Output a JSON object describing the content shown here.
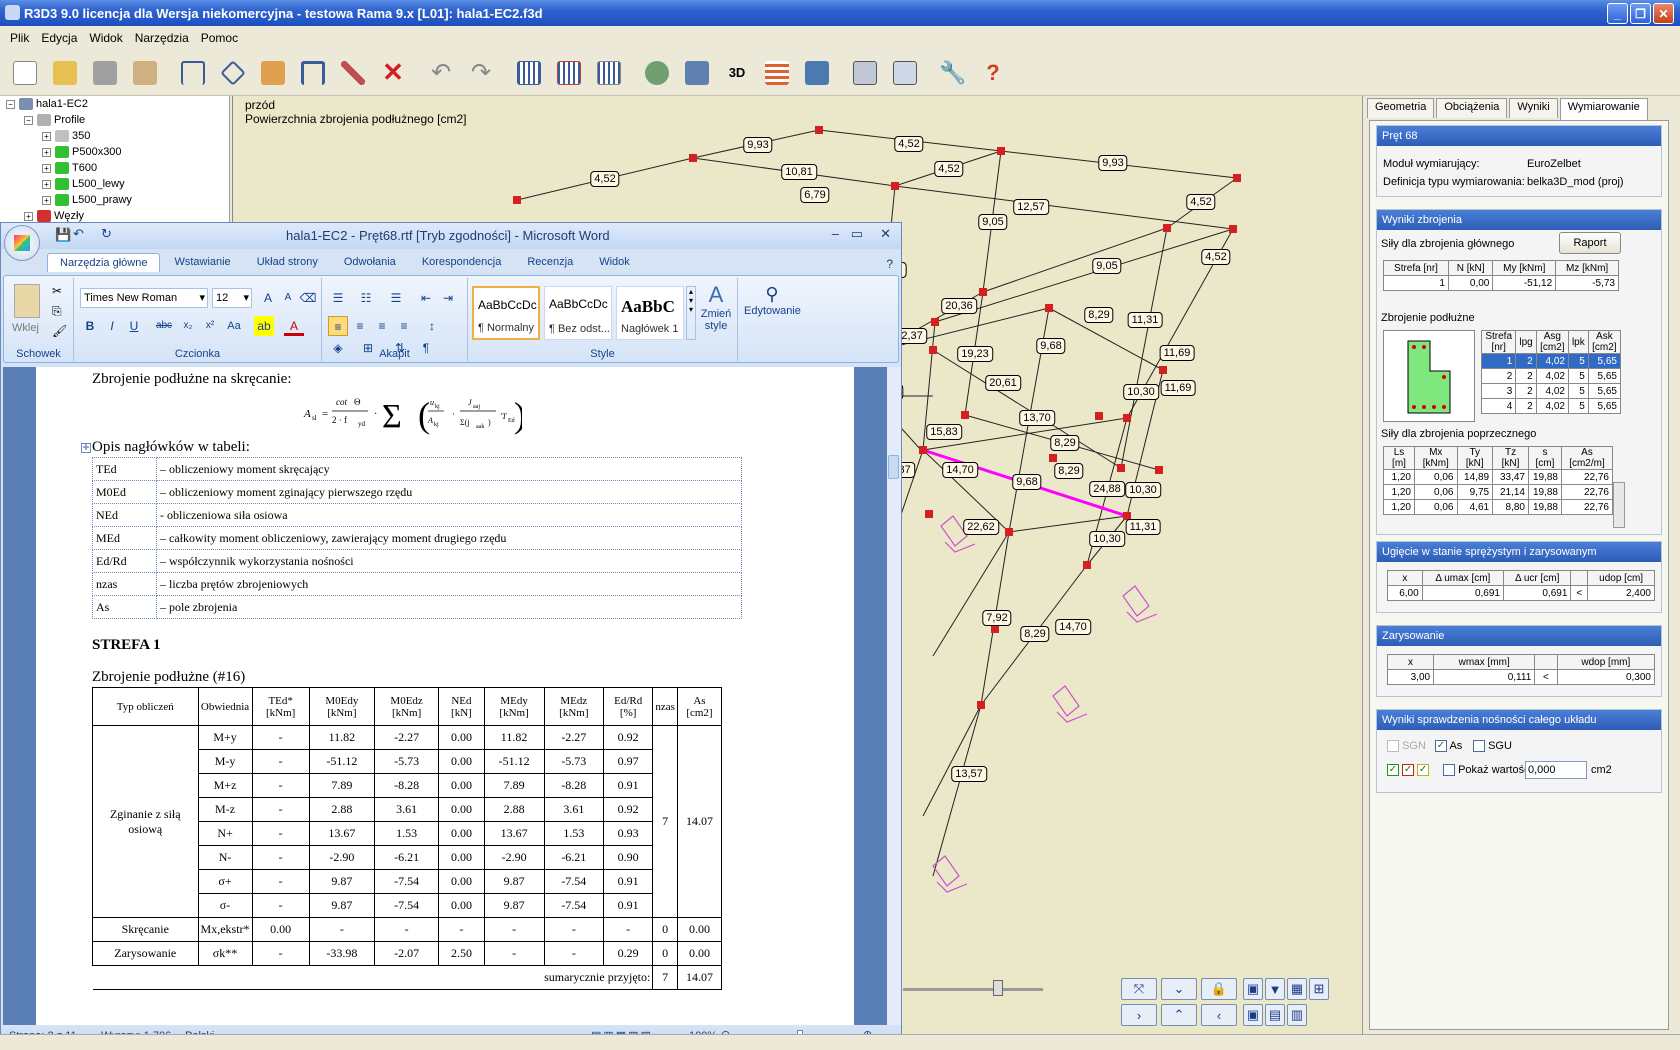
{
  "app": {
    "title": "R3D3 9.0 licencja dla Wersja niekomercyjna - testowa Rama 9.x [L01]: hala1-EC2.f3d",
    "menu": [
      "Plik",
      "Edycja",
      "Widok",
      "Narzędzia",
      "Pomoc"
    ]
  },
  "tree": {
    "items": [
      {
        "label": "hala1-EC2",
        "indent": 0
      },
      {
        "label": "Profile",
        "indent": 1
      },
      {
        "label": "350",
        "indent": 2
      },
      {
        "label": "P500x300",
        "indent": 2
      },
      {
        "label": "T600",
        "indent": 2
      },
      {
        "label": "L500_lewy",
        "indent": 2
      },
      {
        "label": "L500_prawy",
        "indent": 2
      },
      {
        "label": "Węzły",
        "indent": 0
      }
    ]
  },
  "view": {
    "caption1": "przód",
    "caption2": "Powierzchnia zbrojenia podłużnego [cm2]",
    "labels": [
      "4,52",
      "9,93",
      "4,52",
      "10,81",
      "4,52",
      "9,93",
      "6,79",
      "12,57",
      "9,05",
      "4,52",
      "9,05",
      "4,52",
      "11,31",
      "20,36",
      "8,29",
      "11,31",
      "22,37",
      "19,23",
      "9,68",
      "11,69",
      "20,61",
      "10,30",
      "11,69",
      "9,05",
      "9,05",
      "15,83",
      "13,70",
      "8,29",
      "14,70",
      "9,68",
      "8,29",
      "22,37",
      "24,88",
      "10,30",
      "11,69",
      "22,62",
      "11,31",
      "10,30",
      "9,05",
      "7,92",
      "8,29",
      "14,70",
      "13,70",
      "13,57"
    ]
  },
  "right": {
    "tabs": [
      "Geometria",
      "Obciążenia",
      "Wyniki",
      "Wymiarowanie"
    ],
    "header": "Pręt 68",
    "modul_label": "Moduł wymiarujący:",
    "modul_value": "EuroZelbet",
    "def_label": "Definicja typu wymiarowania:",
    "def_value": "belka3D_mod (proj)",
    "wyniki_title": "Wyniki zbrojenia",
    "sily_glowne_label": "Siły dla zbrojenia głównego",
    "raport": "Raport",
    "sily_head": [
      "Strefa [nr]",
      "N [kN]",
      "My [kNm]",
      "Mz [kNm]"
    ],
    "sily_row": [
      "1",
      "0,00",
      "-51,12",
      "-5,73"
    ],
    "zbr_podl_label": "Zbrojenie podłużne",
    "zbr_head": [
      "Strefa [nr]",
      "lpg",
      "Asg [cm2]",
      "lpk",
      "Ask [cm2]"
    ],
    "zbr_rows": [
      [
        "1",
        "2",
        "4,02",
        "5",
        "5,65"
      ],
      [
        "2",
        "2",
        "4,02",
        "5",
        "5,65"
      ],
      [
        "3",
        "2",
        "4,02",
        "5",
        "5,65"
      ],
      [
        "4",
        "2",
        "4,02",
        "5",
        "5,65"
      ]
    ],
    "poprz_label": "Siły dla zbrojenia poprzecznego",
    "poprz_head": [
      "Ls [m]",
      "Mx [kNm]",
      "Ty [kN]",
      "Tz [kN]",
      "s [cm]",
      "As [cm2/m]"
    ],
    "poprz_rows": [
      [
        "1,20",
        "0,06",
        "14,89",
        "33,47",
        "19,88",
        "22,76"
      ],
      [
        "1,20",
        "0,06",
        "9,75",
        "21,14",
        "19,88",
        "22,76"
      ],
      [
        "1,20",
        "0,06",
        "4,61",
        "8,80",
        "19,88",
        "22,76"
      ]
    ],
    "ugiecie_title": "Ugięcie w stanie sprężystym i zarysowanym",
    "ugiecie_head": [
      "x",
      "Δ umax [cm]",
      "Δ ucr [cm]",
      "",
      "udop [cm]"
    ],
    "ugiecie_row": [
      "6,00",
      "0,691",
      "0,691",
      "<",
      "2,400"
    ],
    "zarys_title": "Zarysowanie",
    "zarys_head": [
      "x",
      "wmax [mm]",
      "",
      "wdop [mm]"
    ],
    "zarys_row": [
      "3,00",
      "0,111",
      "<",
      "0,300"
    ],
    "nosnosc_title": "Wyniki sprawdzenia nośności całego układu",
    "sgn": "SGN",
    "as": "As",
    "sgu": "SGU",
    "pokaz_label": "Pokaż wartości >",
    "pokaz_value": "0,000",
    "pokaz_unit": "cm2"
  },
  "word": {
    "title": "hala1-EC2 - Pręt68.rtf [Tryb zgodności] - Microsoft Word",
    "tabs": [
      "Narzędzia główne",
      "Wstawianie",
      "Układ strony",
      "Odwołania",
      "Korespondencja",
      "Recenzja",
      "Widok"
    ],
    "font": "Times New Roman",
    "size": "12",
    "groups": [
      "Schowek",
      "Czcionka",
      "Akapit",
      "Style"
    ],
    "paste": "Wklej",
    "styles": [
      {
        "sample": "AaBbCcDc",
        "name": "¶ Normalny"
      },
      {
        "sample": "AaBbCcDc",
        "name": "¶ Bez odst..."
      },
      {
        "sample": "AaBbC",
        "name": "Nagłówek 1"
      }
    ],
    "change_style": "Zmień style",
    "editing": "Edytowanie",
    "doc": {
      "heading1": "Zbrojenie podłużne na skręcanie:",
      "opis": "Opis nagłówków w tabeli:",
      "desc": [
        [
          "TEd",
          "– obliczeniowy moment skręcający"
        ],
        [
          "M0Ed",
          "– obliczeniowy moment zginający pierwszego rzędu"
        ],
        [
          "NEd",
          "- obliczeniowa siła osiowa"
        ],
        [
          "MEd",
          "– całkowity moment obliczeniowy, zawierający moment drugiego rzędu"
        ],
        [
          "Ed/Rd",
          "– współczynnik wykorzystania nośności"
        ],
        [
          "nzas",
          "– liczba prętów zbrojeniowych"
        ],
        [
          "As",
          "– pole zbrojenia"
        ]
      ],
      "strefa": "STREFA 1",
      "zbr_title": "Zbrojenie podłużne (#16)",
      "table_head": [
        "Typ obliczeń",
        "Obwiednia",
        "TEd* [kNm]",
        "M0Edy [kNm]",
        "M0Edz [kNm]",
        "NEd [kN]",
        "MEdy [kNm]",
        "MEdz [kNm]",
        "Ed/Rd [%]",
        "nzas",
        "As [cm2]"
      ],
      "group1": "Zginanie z siłą osiową",
      "rows": [
        [
          "M+y",
          "-",
          "11.82",
          "-2.27",
          "0.00",
          "11.82",
          "-2.27",
          "0.92"
        ],
        [
          "M-y",
          "-",
          "-51.12",
          "-5.73",
          "0.00",
          "-51.12",
          "-5.73",
          "0.97"
        ],
        [
          "M+z",
          "-",
          "7.89",
          "-8.28",
          "0.00",
          "7.89",
          "-8.28",
          "0.91"
        ],
        [
          "M-z",
          "-",
          "2.88",
          "3.61",
          "0.00",
          "2.88",
          "3.61",
          "0.92"
        ],
        [
          "N+",
          "-",
          "13.67",
          "1.53",
          "0.00",
          "13.67",
          "1.53",
          "0.93"
        ],
        [
          "N-",
          "-",
          "-2.90",
          "-6.21",
          "0.00",
          "-2.90",
          "-6.21",
          "0.90"
        ],
        [
          "σ+",
          "-",
          "9.87",
          "-7.54",
          "0.00",
          "9.87",
          "-7.54",
          "0.91"
        ],
        [
          "σ-",
          "-",
          "9.87",
          "-7.54",
          "0.00",
          "9.87",
          "-7.54",
          "0.91"
        ]
      ],
      "group1_nzas": "7",
      "group1_as": "14.07",
      "skrecanie": [
        "Skręcanie",
        "Mx,ekstr*",
        "0.00",
        "-",
        "-",
        "-",
        "-",
        "-",
        "-",
        "0",
        "0.00"
      ],
      "zarysowanie": [
        "Zarysowanie",
        "σk**",
        "-",
        "-33.98",
        "-2.07",
        "2.50",
        "-",
        "-",
        "0.29",
        "0",
        "0.00"
      ],
      "sum_label": "sumarycznie przyjęto:",
      "sum_n": "7",
      "sum_as": "14.07"
    },
    "status": {
      "page": "Strona: 2 z 11",
      "words": "Wyrazy: 1 706",
      "lang": "Polski",
      "zoom": "100%"
    }
  }
}
